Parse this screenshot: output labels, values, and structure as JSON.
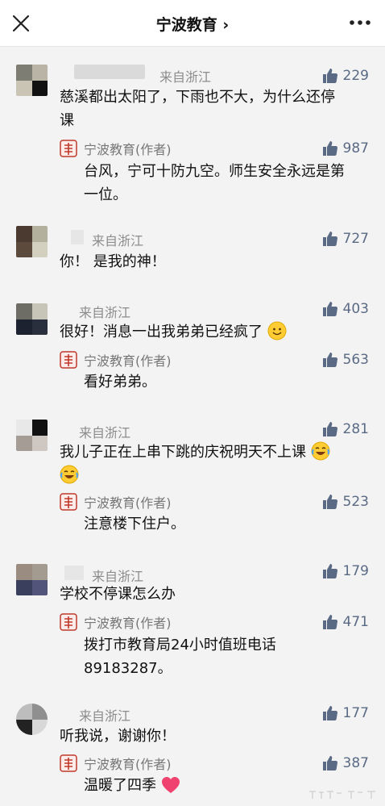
{
  "header": {
    "title": "宁波教育 ›"
  },
  "author_name": "宁波教育(作者)",
  "comments": [
    {
      "location": "来自浙江",
      "likes": "229",
      "text_line1": "慈溪都出太阳了，下雨也不大，为什么还停",
      "text_line2": "课",
      "reply": {
        "likes": "987",
        "text_line1": "台风，宁可十防九空。师生安全永远是第",
        "text_line2": "一位。"
      }
    },
    {
      "location": "来自浙江",
      "likes": "727",
      "text": "你！ 是我的神！"
    },
    {
      "location": "来自浙江",
      "likes": "403",
      "text": "很好！消息一出我弟弟已经疯了",
      "reply": {
        "likes": "563",
        "text": "看好弟弟。"
      }
    },
    {
      "location": "来自浙江",
      "likes": "281",
      "text": "我儿子正在上串下跳的庆祝明天不上课",
      "reply": {
        "likes": "523",
        "text": "注意楼下住户。"
      }
    },
    {
      "location": "来自浙江",
      "likes": "179",
      "text": "学校不停课怎么办",
      "reply": {
        "likes": "471",
        "text_line1": "拨打市教育局24小时值班电话",
        "text_line2": "89183287。"
      }
    },
    {
      "location": "来自浙江",
      "likes": "177",
      "text": "听我说，谢谢你！",
      "reply": {
        "likes": "387",
        "text": "温暖了四季"
      }
    }
  ],
  "icons": {
    "close": "close-icon",
    "more": "more-icon",
    "like": "thumbs-up-icon",
    "author_avatar": "ningbo-education-logo"
  },
  "colors": {
    "like": "#5a6a85",
    "location": "#8c8c8c",
    "author_logo": "#c0392b",
    "background": "#f3f3f3"
  }
}
